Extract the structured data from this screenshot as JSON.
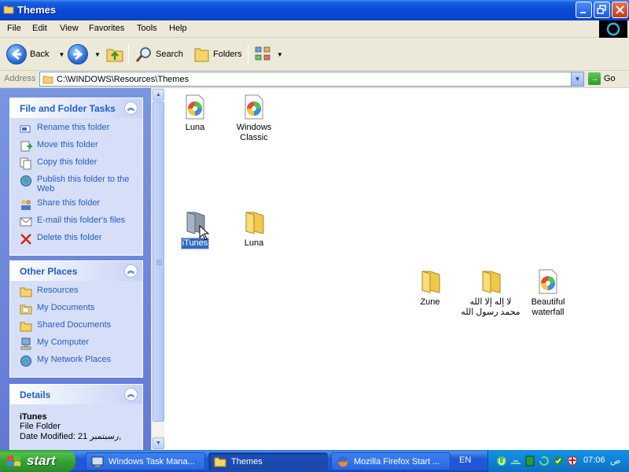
{
  "window": {
    "title": "Themes"
  },
  "menu": {
    "items": [
      "File",
      "Edit",
      "View",
      "Favorites",
      "Tools",
      "Help"
    ]
  },
  "toolbar": {
    "back_label": "Back",
    "search_label": "Search",
    "folders_label": "Folders"
  },
  "address": {
    "label": "Address",
    "value": "C:\\WINDOWS\\Resources\\Themes",
    "go_label": "Go"
  },
  "tasks_panel": {
    "title": "File and Folder Tasks",
    "items": [
      {
        "label": "Rename this folder",
        "icon": "rename-icon"
      },
      {
        "label": "Move this folder",
        "icon": "move-icon"
      },
      {
        "label": "Copy this folder",
        "icon": "copy-icon"
      },
      {
        "label": "Publish this folder to the Web",
        "icon": "publish-web-icon"
      },
      {
        "label": "Share this folder",
        "icon": "share-icon"
      },
      {
        "label": "E-mail this folder's files",
        "icon": "email-icon"
      },
      {
        "label": "Delete this folder",
        "icon": "delete-icon"
      }
    ]
  },
  "places_panel": {
    "title": "Other Places",
    "items": [
      {
        "label": "Resources",
        "icon": "folder-icon"
      },
      {
        "label": "My Documents",
        "icon": "my-documents-icon"
      },
      {
        "label": "Shared Documents",
        "icon": "folder-icon"
      },
      {
        "label": "My Computer",
        "icon": "my-computer-icon"
      },
      {
        "label": "My Network Places",
        "icon": "network-icon"
      }
    ]
  },
  "details_panel": {
    "title": "Details",
    "name": "iTunes",
    "type": "File Folder",
    "modified": "Date Modified: 21 رسبتمبر,"
  },
  "files": [
    {
      "label": "Luna",
      "kind": "theme"
    },
    {
      "label": "Windows Classic",
      "kind": "theme"
    },
    {
      "label": "iTunes",
      "kind": "folder-gray",
      "selected": true
    },
    {
      "label": "Luna",
      "kind": "folder"
    },
    {
      "label": "Zune",
      "kind": "folder"
    },
    {
      "label": "لا إله إلا الله محمد رسول الله",
      "kind": "folder"
    },
    {
      "label": "Beautiful waterfall",
      "kind": "theme"
    }
  ],
  "taskbar": {
    "start_label": "start",
    "buttons": [
      {
        "label": "Windows Task Mana...",
        "icon": "task-manager-icon"
      },
      {
        "label": "Themes",
        "icon": "folder-icon"
      },
      {
        "label": "Mozilla Firefox Start ...",
        "icon": "firefox-icon"
      }
    ],
    "language": "EN",
    "clock": "07:06",
    "ampm": "ص"
  },
  "colors": {
    "titlebar": "#0a48d8",
    "link": "#215dc6",
    "selection": "#316ac5",
    "taskbar": "#2157d7",
    "start": "#36a336"
  }
}
